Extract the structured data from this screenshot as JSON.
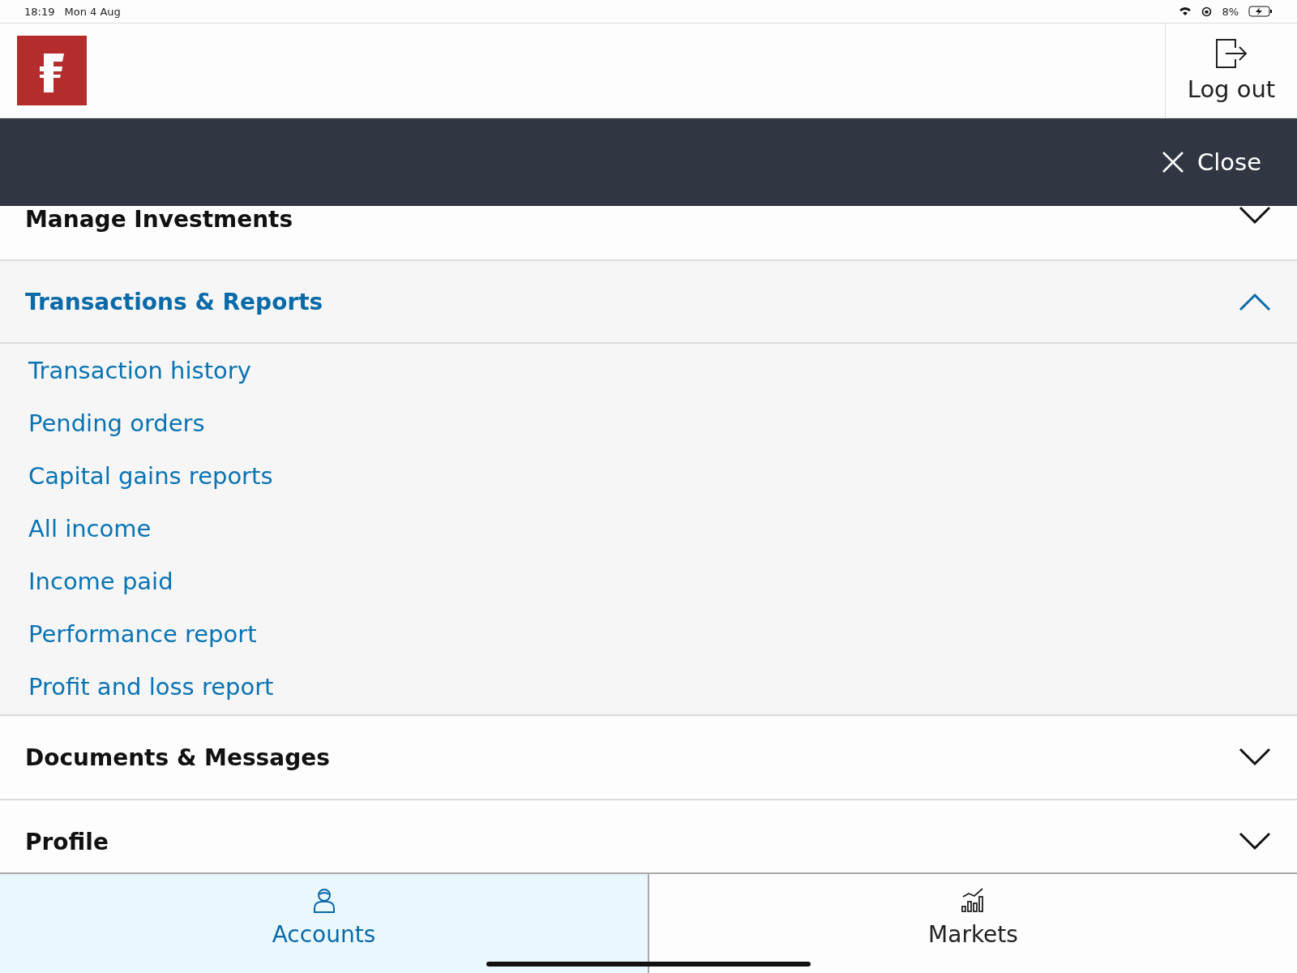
{
  "status_bar": {
    "time": "18:19",
    "date": "Mon 4 Aug",
    "battery": "8%"
  },
  "header": {
    "logout": "Log out"
  },
  "close_bar": {
    "close": "Close"
  },
  "sections": [
    {
      "title": "Manage Investments",
      "expanded": false
    },
    {
      "title": "Transactions & Reports",
      "expanded": true,
      "children": [
        {
          "label": "Transaction history"
        },
        {
          "label": "Pending orders"
        },
        {
          "label": "Capital gains reports"
        },
        {
          "label": "All income"
        },
        {
          "label": "Income paid"
        },
        {
          "label": "Performance report"
        },
        {
          "label": "Profit and loss report"
        }
      ]
    },
    {
      "title": "Documents & Messages",
      "expanded": false
    },
    {
      "title": "Profile",
      "expanded": false
    }
  ],
  "tabs": [
    {
      "label": "Accounts",
      "selected": true,
      "kind": "person"
    },
    {
      "label": "Markets",
      "selected": false,
      "kind": "chart"
    }
  ]
}
